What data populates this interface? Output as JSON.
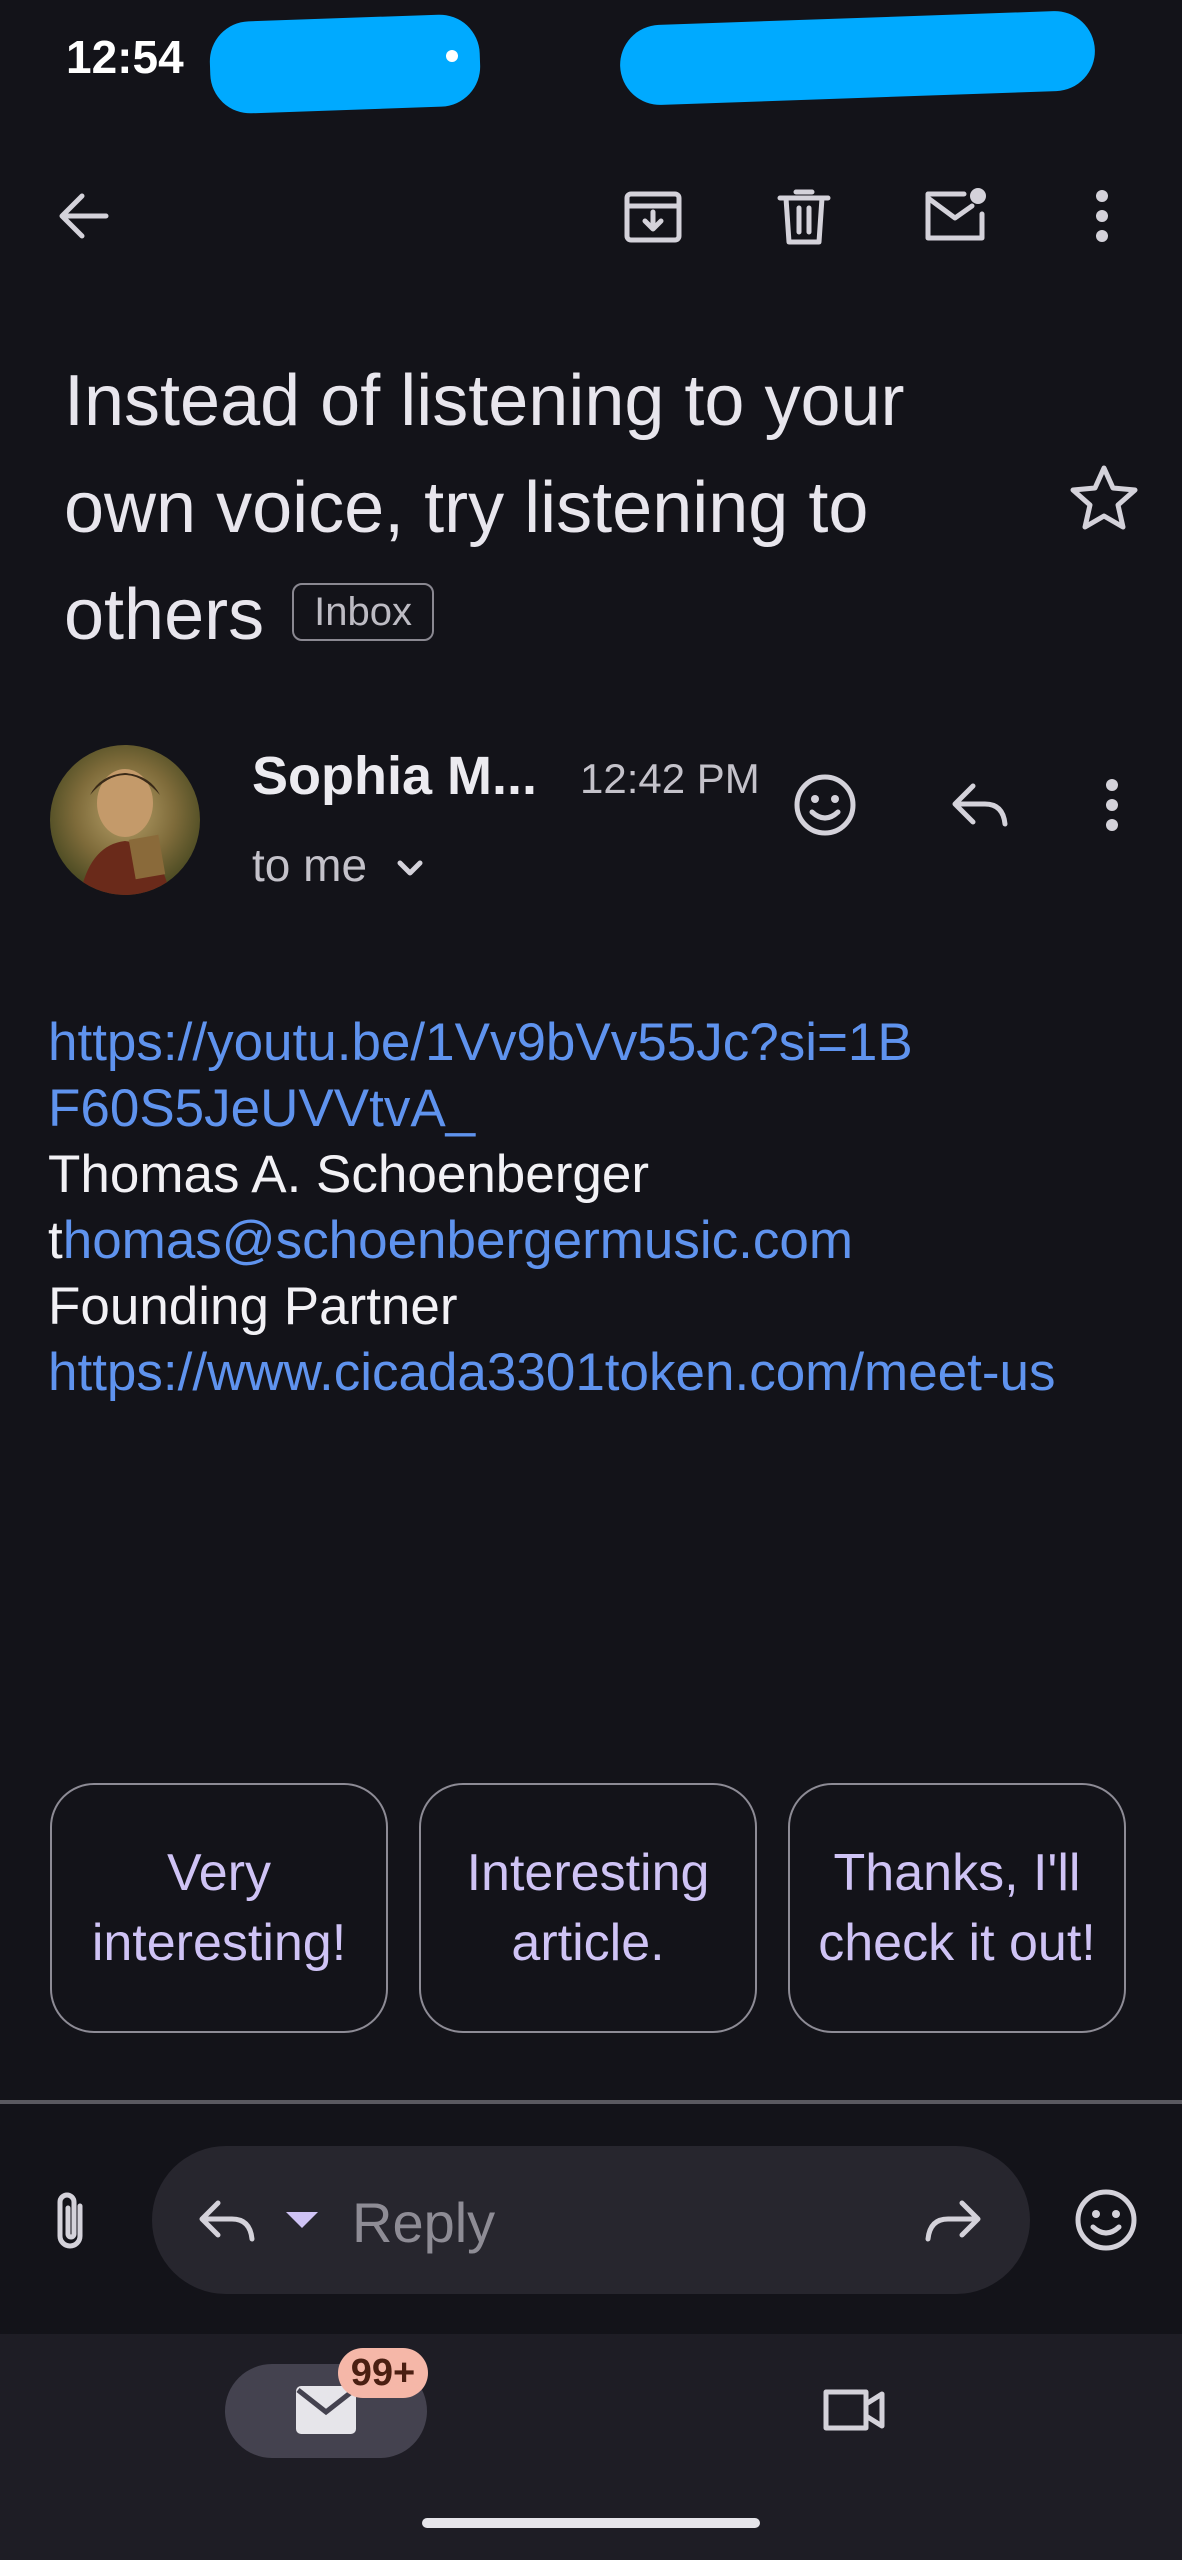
{
  "status_bar": {
    "time": "12:54"
  },
  "toolbar": {
    "back_icon": "arrow-left",
    "archive_icon": "archive",
    "delete_icon": "trash",
    "mark_unread_icon": "mail-unread",
    "more_icon": "more-vert"
  },
  "email": {
    "subject": "Instead of listening to your own voice, try listening to others",
    "label": "Inbox",
    "sender": "Sophia M...",
    "time": "12:42 PM",
    "recipient": "to me",
    "body": {
      "link1": "https://youtu.be/1Vv9bVv55Jc?si=1BF60S5JeUVVtvA_",
      "name": "Thomas A. Schoenberger",
      "email_prefix": "t",
      "email_link": "homas@schoenbergermusic.com",
      "title": "Founding Partner",
      "link2": "https://www.cicada3301token.com/meet-us"
    }
  },
  "smart_replies": [
    "Very interesting!",
    "Interesting article.",
    "Thanks, I'll check it out!"
  ],
  "reply_bar": {
    "placeholder": "Reply"
  },
  "bottom_nav": {
    "mail_badge": "99+"
  },
  "colors": {
    "background": "#131319",
    "link": "#5f93ee",
    "chip_text": "#cfc3f5",
    "badge": "#f5b7a8"
  }
}
